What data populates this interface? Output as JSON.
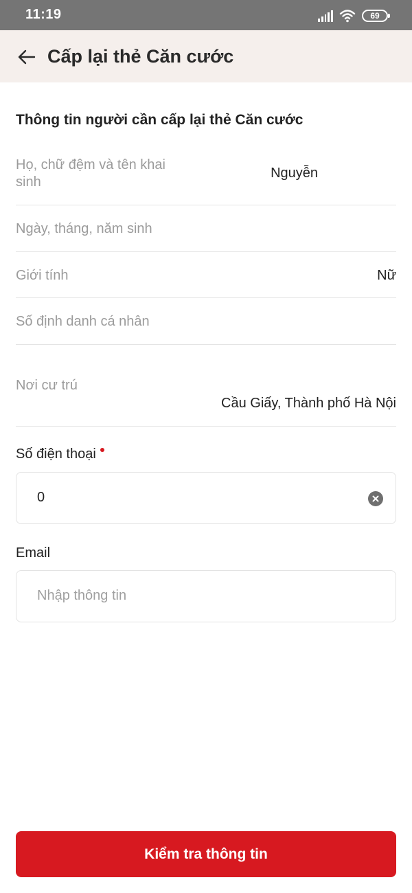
{
  "status_bar": {
    "time": "11:19",
    "battery": "69",
    "icons": [
      "signal-icon",
      "wifi-icon",
      "battery-icon"
    ]
  },
  "header": {
    "back_icon": "arrow-left-icon",
    "title": "Cấp lại thẻ Căn cước",
    "background": "#f5efec"
  },
  "section": {
    "title": "Thông tin người cần cấp lại thẻ Căn cước"
  },
  "info_rows": [
    {
      "label_line1": "Họ, chữ đệm và tên khai",
      "label_line2": "sinh",
      "value": "Nguyễn"
    },
    {
      "label": "Ngày, tháng, năm sinh",
      "value": ""
    },
    {
      "label": "Giới tính",
      "value": "Nữ"
    },
    {
      "label": "Số định danh cá nhân",
      "value": ""
    },
    {
      "label": "Nơi cư trú",
      "value": "Cầu Giấy, Thành phố Hà Nội"
    }
  ],
  "phone": {
    "label": "Số điện thoại",
    "required": true,
    "value": "0",
    "clear_icon": "clear-circle-icon"
  },
  "email": {
    "label": "Email",
    "value": "",
    "placeholder": "Nhập thông tin"
  },
  "submit": {
    "label": "Kiểm tra thông tin"
  },
  "colors": {
    "accent": "#d71920",
    "label_gray": "#9b9b9b",
    "status_bar": "#757575"
  }
}
